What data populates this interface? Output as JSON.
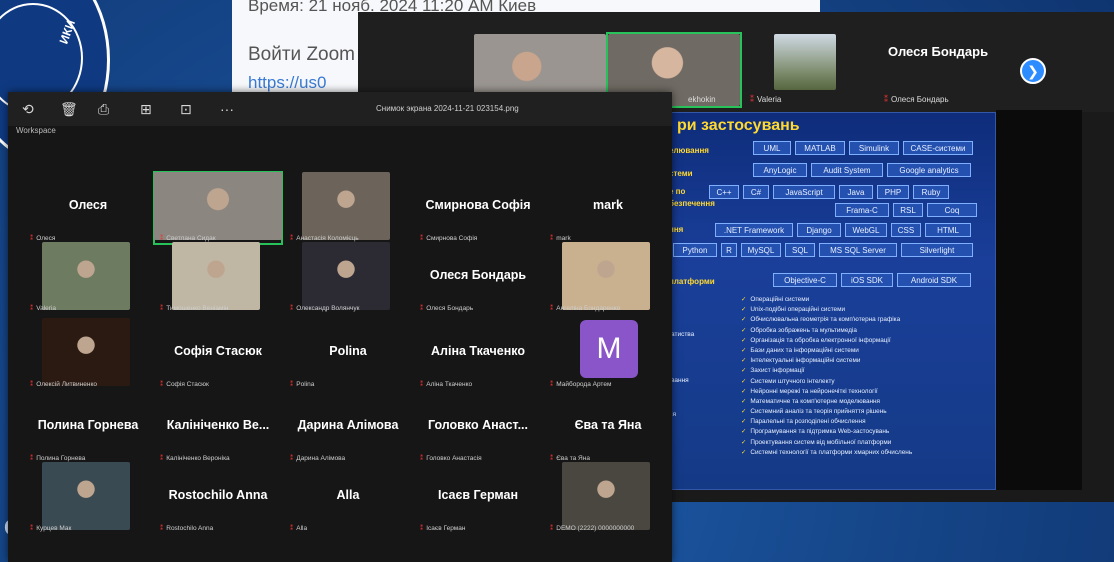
{
  "chat": {
    "line1": "Время: 21 нояб. 2024 11:20 AM Киев",
    "line2": "Войти Zoom",
    "line3": "https://us0"
  },
  "background": {
    "logo_text": "ИКИ",
    "bottom_letter": "C"
  },
  "zoom_back": {
    "strip": [
      {
        "label": "",
        "cam": "#9a9590"
      },
      {
        "label": "ekhokin",
        "cam": "#6f6a63",
        "active": true
      },
      {
        "label": "Valeria",
        "cam": "#3a3a3a"
      },
      {
        "label": "Valerie",
        "cam": "#77836a"
      }
    ],
    "featured_name": "Олеся Бондарь",
    "featured_label": "Олеся Бондарь",
    "next_icon": "chevron-right-icon"
  },
  "slide": {
    "title": "ри застосувань",
    "left_labels": [
      "елювання",
      "стеми",
      "е по",
      "безпечення",
      "ння",
      "платформи"
    ],
    "chips_row1": [
      "UML",
      "MATLAB",
      "Simulink",
      "CASE-системи"
    ],
    "chips_row2": [
      "AnyLogic",
      "Audit System",
      "Google analytics"
    ],
    "chips_row3": [
      "C++",
      "C#",
      "JavaScript",
      "Java",
      "PHP",
      "Ruby"
    ],
    "chips_row4": [
      "Frama-C",
      "RSL",
      "Coq"
    ],
    "chips_row5": [
      ".NET Framework",
      "Django",
      "WebGL",
      "CSS",
      "HTML"
    ],
    "chips_row6": [
      "Python",
      "R",
      "MySQL",
      "SQL",
      "MS SQL Server",
      "Silverlight"
    ],
    "chips_row7": [
      "Objective-C",
      "iOS SDK",
      "Android SDK"
    ],
    "side_labels": [
      "атиства",
      "вання",
      "ія"
    ],
    "list": [
      "Операційні системи",
      "Unix-подібні операційні системи",
      "Обчислювальна геометрія та комп'ютерна графіка",
      "Обробка зображень та мультимедіа",
      "Організація та обробка електронної інформації",
      "Бази даних та інформаційні системи",
      "Інтелектуальні інформаційні системи",
      "Захист інформації",
      "Системи штучного інтелекту",
      "Нейронні мережі та нейронечіткі технології",
      "Математичне та комп'ютерне моделювання",
      "Системний аналіз та теорія прийняття рішень",
      "Паралельні та розподілені обчислення",
      "Програмування та підтримка Web-застосувань",
      "Проектування систем від мобільної платформи",
      "Системні технології та платформи хмарних обчислень"
    ]
  },
  "zoom_front": {
    "title": "Снимок экрана 2024-11-21 023154.png",
    "workspace": "Workspace",
    "tools": [
      "⟲",
      "🗑",
      "⎙",
      "⊞",
      "⊡",
      "···"
    ],
    "tiles": [
      {
        "name": "Олеся",
        "label": "Олеся",
        "cam": ""
      },
      {
        "name": "",
        "label": "Светлана Сидак",
        "cam": "#8b8680",
        "active": true
      },
      {
        "name": "",
        "label": "Анастасія Коломієць",
        "cam": "#6c645a"
      },
      {
        "name": "Смирнова Софія",
        "label": "Смирнова Софія",
        "cam": ""
      },
      {
        "name": "mark",
        "label": "mark",
        "cam": ""
      },
      {
        "name": "",
        "label": "Valeria",
        "cam": "#6d7b60"
      },
      {
        "name": "",
        "label": "Тимошенко Веніамін",
        "cam": "#bfb6a3"
      },
      {
        "name": "",
        "label": "Олександр Волянчук",
        "cam": "#2c2a33"
      },
      {
        "name": "Олеся Бондарь",
        "label": "Олеся Бондарь",
        "cam": ""
      },
      {
        "name": "",
        "label": "Ангеліна Бондаренко",
        "cam": "#c9b08e"
      },
      {
        "name": "",
        "label": "Олексій Литвиненко",
        "cam": "#2a1a12"
      },
      {
        "name": "Софія Стасюк",
        "label": "Софія Стасюк",
        "cam": ""
      },
      {
        "name": "Polina",
        "label": "Polina",
        "cam": ""
      },
      {
        "name": "Аліна Ткаченко",
        "label": "Аліна Ткаченко",
        "cam": ""
      },
      {
        "name": "",
        "label": "Майборода Артем",
        "cam": "",
        "avatar": "M"
      },
      {
        "name": "Полина Горнева",
        "label": "Полина Горнева",
        "cam": ""
      },
      {
        "name": "Калініченко Ве...",
        "label": "Калініченко Вероніка",
        "cam": ""
      },
      {
        "name": "Дарина Алімова",
        "label": "Дарина Алімова",
        "cam": ""
      },
      {
        "name": "Головко Анаст...",
        "label": "Головко Анастасія",
        "cam": ""
      },
      {
        "name": "Єва та Яна",
        "label": "Єва та Яна",
        "cam": ""
      },
      {
        "name": "",
        "label": "Курцев Мак",
        "cam": "#3a4a52"
      },
      {
        "name": "Rostochilo Anna",
        "label": "Rostochilo Anna",
        "cam": ""
      },
      {
        "name": "Alla",
        "label": "Alla",
        "cam": ""
      },
      {
        "name": "Ісаєв Герман",
        "label": "Ісаєв Герман",
        "cam": ""
      },
      {
        "name": "",
        "label": "DEMO (2222) 0000000000",
        "cam": "#4a4740"
      }
    ]
  }
}
